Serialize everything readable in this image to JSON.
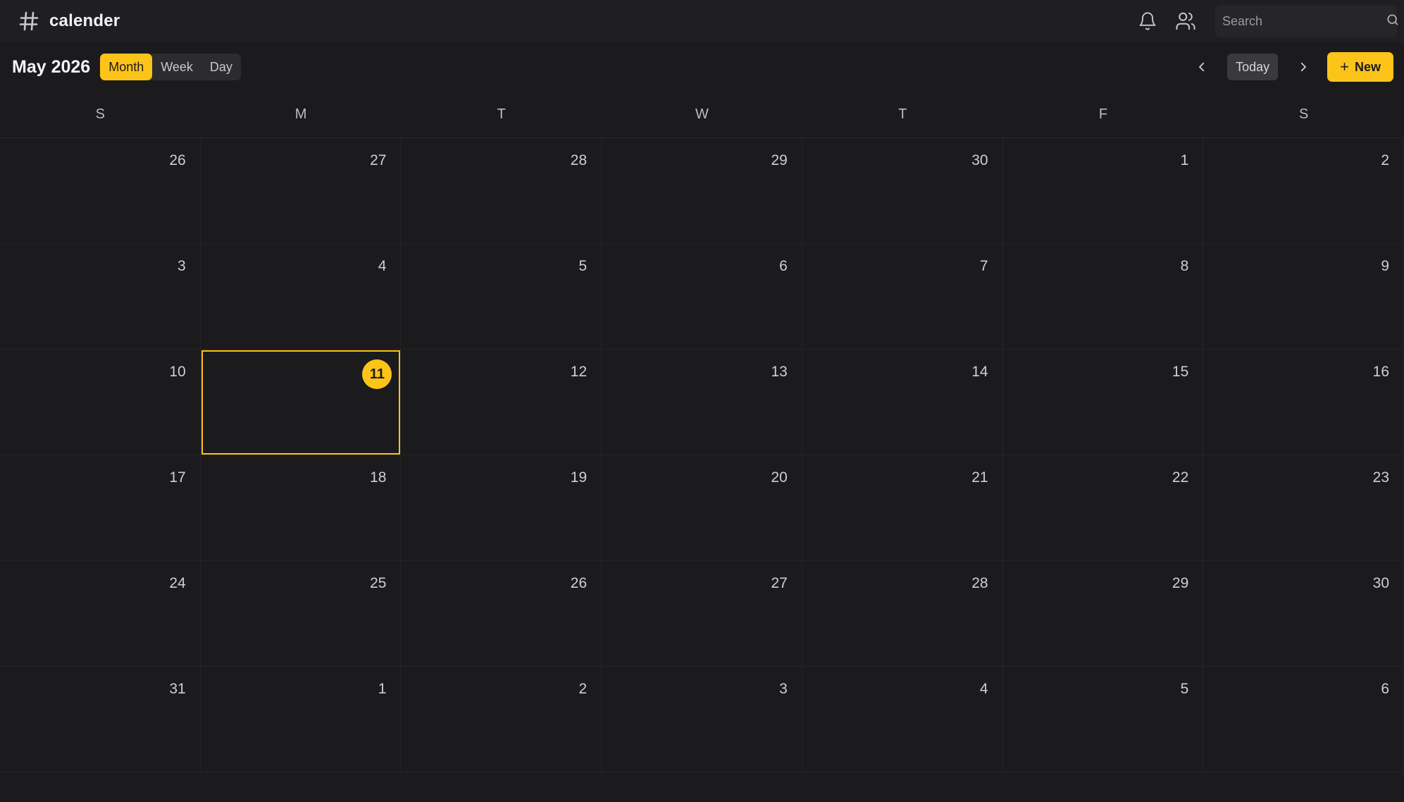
{
  "app": {
    "name": "calender",
    "logo_icon": "hash-icon"
  },
  "header": {
    "notifications_icon": "bell-icon",
    "people_icon": "users-icon",
    "search": {
      "placeholder": "Search",
      "value": "",
      "icon": "search-icon"
    }
  },
  "toolbar": {
    "title": "May 2026",
    "views": [
      "Month",
      "Week",
      "Day"
    ],
    "active_view": "Month",
    "prev_icon": "chevron-left-icon",
    "next_icon": "chevron-right-icon",
    "today_label": "Today",
    "new_label": "New"
  },
  "colors": {
    "accent": "#fcc419",
    "background": "#1b1b1d"
  },
  "calendar": {
    "weekdays": [
      "S",
      "M",
      "T",
      "W",
      "T",
      "F",
      "S"
    ],
    "today": 11,
    "weeks": [
      [
        "26",
        "27",
        "28",
        "29",
        "30",
        "1",
        "2"
      ],
      [
        "3",
        "4",
        "5",
        "6",
        "7",
        "8",
        "9"
      ],
      [
        "10",
        "11",
        "12",
        "13",
        "14",
        "15",
        "16"
      ],
      [
        "17",
        "18",
        "19",
        "20",
        "21",
        "22",
        "23"
      ],
      [
        "24",
        "25",
        "26",
        "27",
        "28",
        "29",
        "30"
      ],
      [
        "31",
        "1",
        "2",
        "3",
        "4",
        "5",
        "6"
      ]
    ]
  }
}
